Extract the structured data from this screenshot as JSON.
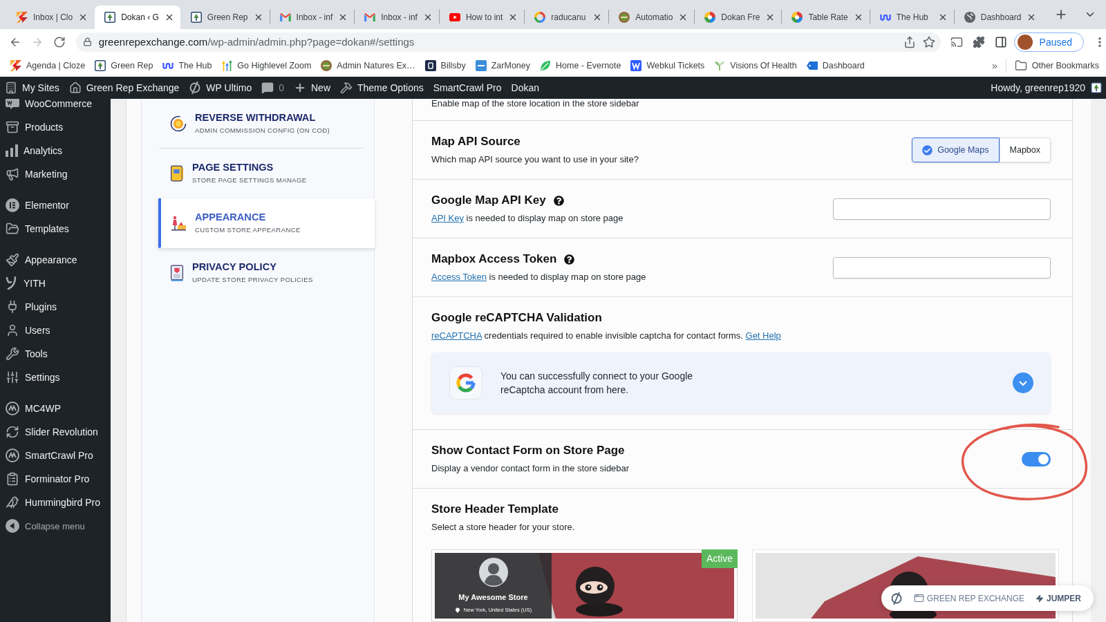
{
  "browser": {
    "tabs": [
      {
        "title": "Inbox | Clo",
        "selected": false
      },
      {
        "title": "Dokan ‹ G",
        "selected": true
      },
      {
        "title": "Green Rep",
        "selected": false
      },
      {
        "title": "Inbox - inf",
        "selected": false
      },
      {
        "title": "Inbox - inf",
        "selected": false
      },
      {
        "title": "How to int",
        "selected": false
      },
      {
        "title": "raducanu",
        "selected": false
      },
      {
        "title": "Automatio",
        "selected": false
      },
      {
        "title": "Dokan Fre",
        "selected": false
      },
      {
        "title": "Table Rate",
        "selected": false
      },
      {
        "title": "The Hub",
        "selected": false
      },
      {
        "title": "Dashboard",
        "selected": false
      }
    ],
    "forward": {
      "disabled": true
    },
    "address": {
      "domain": "greenrepexchange.com",
      "path": "/wp-admin/admin.php?page=dokan#/settings"
    },
    "profile": {
      "label": "Paused"
    },
    "bookmarks": [
      {
        "label": "Agenda | Cloze"
      },
      {
        "label": "Green Rep"
      },
      {
        "label": "The Hub"
      },
      {
        "label": "Go Highlevel Zoom"
      },
      {
        "label": "Admin Natures Ex…"
      },
      {
        "label": "Billsby"
      },
      {
        "label": "ZarMoney"
      },
      {
        "label": "Home - Evernote"
      },
      {
        "label": "Webkul Tickets"
      },
      {
        "label": "Visions Of Health"
      },
      {
        "label": "Dashboard"
      }
    ],
    "more_bookmarks": "»",
    "other_bookmarks": "Other Bookmarks"
  },
  "admin_bar": {
    "items": [
      {
        "label": "My Sites",
        "kind": "link"
      },
      {
        "label": "Green Rep Exchange",
        "kind": "link"
      },
      {
        "label": "WP Ultimo",
        "kind": "link"
      },
      {
        "label": "0",
        "kind": "count"
      },
      {
        "label": "New",
        "kind": "link"
      },
      {
        "label": "Theme Options",
        "kind": "link"
      },
      {
        "label": "SmartCrawl Pro",
        "kind": "link"
      },
      {
        "label": "Dokan",
        "kind": "link"
      }
    ],
    "greeting": "Howdy, greenrep1920"
  },
  "sidebar": {
    "groups": [
      {
        "items": [
          {
            "label": "WooCommerce",
            "selected": false
          },
          {
            "label": "Products",
            "selected": false
          },
          {
            "label": "Analytics",
            "selected": false
          },
          {
            "label": "Marketing",
            "selected": false
          }
        ]
      },
      {
        "items": [
          {
            "label": "Elementor",
            "selected": false
          },
          {
            "label": "Templates",
            "selected": false
          }
        ]
      },
      {
        "items": [
          {
            "label": "Appearance",
            "selected": false
          },
          {
            "label": "YITH",
            "selected": false
          },
          {
            "label": "Plugins",
            "selected": false
          },
          {
            "label": "Users",
            "selected": false
          },
          {
            "label": "Tools",
            "selected": false
          },
          {
            "label": "Settings",
            "selected": false
          }
        ]
      },
      {
        "items": [
          {
            "label": "MC4WP",
            "selected": false
          },
          {
            "label": "Slider Revolution",
            "selected": false
          },
          {
            "label": "SmartCrawl Pro",
            "selected": false
          },
          {
            "label": "Forminator Pro",
            "selected": false
          },
          {
            "label": "Hummingbird Pro",
            "selected": false
          }
        ]
      }
    ],
    "collapse": "Collapse menu"
  },
  "settings_nav": [
    {
      "title": "REVERSE WITHDRAWAL",
      "subtitle": "ADMIN COMMISSION CONFIG (ON COD)",
      "selected": false
    },
    {
      "title": "PAGE SETTINGS",
      "subtitle": "STORE PAGE SETTINGS MANAGE",
      "selected": false
    },
    {
      "title": "APPEARANCE",
      "subtitle": "CUSTOM STORE APPEARANCE",
      "selected": true
    },
    {
      "title": "PRIVACY POLICY",
      "subtitle": "UPDATE STORE PRIVACY POLICIES",
      "selected": false
    }
  ],
  "settings": {
    "intro": "Enable map of the store location in the store sidebar",
    "sections": [
      {
        "kind": "choice",
        "title": "Map API Source",
        "help": false,
        "description": [
          {
            "text": "Which map API source you want to use in your site?",
            "link": false
          }
        ],
        "options": [
          {
            "label": "Google Maps",
            "selected": true
          },
          {
            "label": "Mapbox",
            "selected": false
          }
        ]
      },
      {
        "kind": "input",
        "title": "Google Map API Key",
        "help": true,
        "description": [
          {
            "text": "API Key",
            "link": true
          },
          {
            "text": " is needed to display map on store page",
            "link": false
          }
        ]
      },
      {
        "kind": "input",
        "title": "Mapbox Access Token",
        "help": true,
        "description": [
          {
            "text": "Access Token",
            "link": true
          },
          {
            "text": " is needed to display map on store page",
            "link": false
          }
        ]
      },
      {
        "kind": "recaptcha",
        "title": "Google reCAPTCHA Validation",
        "help": false,
        "description": [
          {
            "text": "reCAPTCHA",
            "link": true
          },
          {
            "text": " credentials required to enable invisible captcha for contact forms. ",
            "link": false
          },
          {
            "text": "Get Help",
            "link": true
          }
        ],
        "notice": "You can successfully connect to your Google reCaptcha account from here."
      },
      {
        "kind": "toggle",
        "title": "Show Contact Form on Store Page",
        "help": false,
        "description": [
          {
            "text": "Display a vendor contact form in the store sidebar",
            "link": false
          }
        ],
        "on": true
      },
      {
        "kind": "templates",
        "title": "Store Header Template",
        "help": false,
        "description": [
          {
            "text": "Select a store header for your store.",
            "link": false
          }
        ],
        "templates": [
          {
            "selected": true,
            "badge": "Active",
            "store_name": "My Awesome Store",
            "location": "New York, United States (US)"
          },
          {
            "selected": false
          }
        ]
      }
    ]
  },
  "jumper": {
    "site": "GREEN REP EXCHANGE",
    "action": "JUMPER"
  }
}
